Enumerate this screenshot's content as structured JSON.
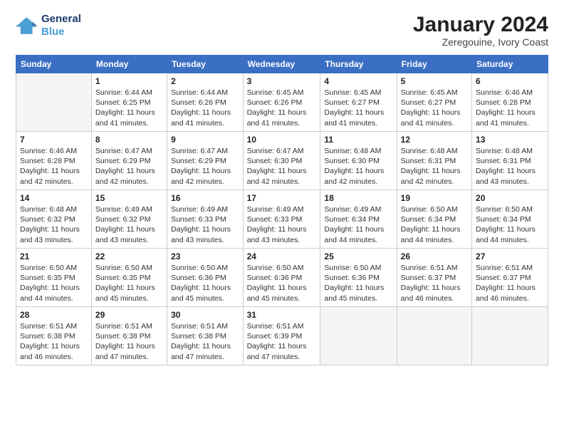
{
  "logo": {
    "line1": "General",
    "line2": "Blue"
  },
  "title": "January 2024",
  "location": "Zeregouine, Ivory Coast",
  "days_of_week": [
    "Sunday",
    "Monday",
    "Tuesday",
    "Wednesday",
    "Thursday",
    "Friday",
    "Saturday"
  ],
  "weeks": [
    [
      {
        "num": "",
        "detail": ""
      },
      {
        "num": "1",
        "detail": "Sunrise: 6:44 AM\nSunset: 6:25 PM\nDaylight: 11 hours\nand 41 minutes."
      },
      {
        "num": "2",
        "detail": "Sunrise: 6:44 AM\nSunset: 6:26 PM\nDaylight: 11 hours\nand 41 minutes."
      },
      {
        "num": "3",
        "detail": "Sunrise: 6:45 AM\nSunset: 6:26 PM\nDaylight: 11 hours\nand 41 minutes."
      },
      {
        "num": "4",
        "detail": "Sunrise: 6:45 AM\nSunset: 6:27 PM\nDaylight: 11 hours\nand 41 minutes."
      },
      {
        "num": "5",
        "detail": "Sunrise: 6:45 AM\nSunset: 6:27 PM\nDaylight: 11 hours\nand 41 minutes."
      },
      {
        "num": "6",
        "detail": "Sunrise: 6:46 AM\nSunset: 6:28 PM\nDaylight: 11 hours\nand 41 minutes."
      }
    ],
    [
      {
        "num": "7",
        "detail": "Sunrise: 6:46 AM\nSunset: 6:28 PM\nDaylight: 11 hours\nand 42 minutes."
      },
      {
        "num": "8",
        "detail": "Sunrise: 6:47 AM\nSunset: 6:29 PM\nDaylight: 11 hours\nand 42 minutes."
      },
      {
        "num": "9",
        "detail": "Sunrise: 6:47 AM\nSunset: 6:29 PM\nDaylight: 11 hours\nand 42 minutes."
      },
      {
        "num": "10",
        "detail": "Sunrise: 6:47 AM\nSunset: 6:30 PM\nDaylight: 11 hours\nand 42 minutes."
      },
      {
        "num": "11",
        "detail": "Sunrise: 6:48 AM\nSunset: 6:30 PM\nDaylight: 11 hours\nand 42 minutes."
      },
      {
        "num": "12",
        "detail": "Sunrise: 6:48 AM\nSunset: 6:31 PM\nDaylight: 11 hours\nand 42 minutes."
      },
      {
        "num": "13",
        "detail": "Sunrise: 6:48 AM\nSunset: 6:31 PM\nDaylight: 11 hours\nand 43 minutes."
      }
    ],
    [
      {
        "num": "14",
        "detail": "Sunrise: 6:48 AM\nSunset: 6:32 PM\nDaylight: 11 hours\nand 43 minutes."
      },
      {
        "num": "15",
        "detail": "Sunrise: 6:49 AM\nSunset: 6:32 PM\nDaylight: 11 hours\nand 43 minutes."
      },
      {
        "num": "16",
        "detail": "Sunrise: 6:49 AM\nSunset: 6:33 PM\nDaylight: 11 hours\nand 43 minutes."
      },
      {
        "num": "17",
        "detail": "Sunrise: 6:49 AM\nSunset: 6:33 PM\nDaylight: 11 hours\nand 43 minutes."
      },
      {
        "num": "18",
        "detail": "Sunrise: 6:49 AM\nSunset: 6:34 PM\nDaylight: 11 hours\nand 44 minutes."
      },
      {
        "num": "19",
        "detail": "Sunrise: 6:50 AM\nSunset: 6:34 PM\nDaylight: 11 hours\nand 44 minutes."
      },
      {
        "num": "20",
        "detail": "Sunrise: 6:50 AM\nSunset: 6:34 PM\nDaylight: 11 hours\nand 44 minutes."
      }
    ],
    [
      {
        "num": "21",
        "detail": "Sunrise: 6:50 AM\nSunset: 6:35 PM\nDaylight: 11 hours\nand 44 minutes."
      },
      {
        "num": "22",
        "detail": "Sunrise: 6:50 AM\nSunset: 6:35 PM\nDaylight: 11 hours\nand 45 minutes."
      },
      {
        "num": "23",
        "detail": "Sunrise: 6:50 AM\nSunset: 6:36 PM\nDaylight: 11 hours\nand 45 minutes."
      },
      {
        "num": "24",
        "detail": "Sunrise: 6:50 AM\nSunset: 6:36 PM\nDaylight: 11 hours\nand 45 minutes."
      },
      {
        "num": "25",
        "detail": "Sunrise: 6:50 AM\nSunset: 6:36 PM\nDaylight: 11 hours\nand 45 minutes."
      },
      {
        "num": "26",
        "detail": "Sunrise: 6:51 AM\nSunset: 6:37 PM\nDaylight: 11 hours\nand 46 minutes."
      },
      {
        "num": "27",
        "detail": "Sunrise: 6:51 AM\nSunset: 6:37 PM\nDaylight: 11 hours\nand 46 minutes."
      }
    ],
    [
      {
        "num": "28",
        "detail": "Sunrise: 6:51 AM\nSunset: 6:38 PM\nDaylight: 11 hours\nand 46 minutes."
      },
      {
        "num": "29",
        "detail": "Sunrise: 6:51 AM\nSunset: 6:38 PM\nDaylight: 11 hours\nand 47 minutes."
      },
      {
        "num": "30",
        "detail": "Sunrise: 6:51 AM\nSunset: 6:38 PM\nDaylight: 11 hours\nand 47 minutes."
      },
      {
        "num": "31",
        "detail": "Sunrise: 6:51 AM\nSunset: 6:39 PM\nDaylight: 11 hours\nand 47 minutes."
      },
      {
        "num": "",
        "detail": ""
      },
      {
        "num": "",
        "detail": ""
      },
      {
        "num": "",
        "detail": ""
      }
    ]
  ]
}
